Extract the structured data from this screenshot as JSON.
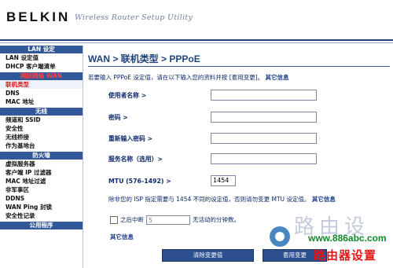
{
  "header": {
    "brand": "BELKIN",
    "tagline": "Wireless Router Setup Utility"
  },
  "sidebar": {
    "sections": [
      {
        "title": "LAN 设定",
        "items": [
          "LAN 设定值",
          "DHCP 客户端清单"
        ]
      },
      {
        "title": "网际网络 WAN",
        "items": [
          "联机类型",
          "DNS",
          "MAC 地址"
        ]
      },
      {
        "title": "无线",
        "items": [
          "频道和 SSID",
          "安全性",
          "无线桥接",
          "作为基地台"
        ]
      },
      {
        "title": "防火墙",
        "items": [
          "虚拟服务器",
          "客户端 IP 过滤器",
          "MAC 地址过滤",
          "非军事区",
          "DDNS",
          "WAN Ping 封锁",
          "安全性记录"
        ]
      },
      {
        "title": "公用程序",
        "items": []
      }
    ],
    "active_item": "联机类型"
  },
  "main": {
    "title": "WAN > 联机类型 > PPPoE",
    "intro": "若要输入 PPPoE 设定值，请在以下输入您的资料并按 [套用变更]。",
    "intro_link": "其它信息",
    "fields": [
      {
        "label": "使用者名称 >",
        "value": ""
      },
      {
        "label": "密码 >",
        "value": ""
      },
      {
        "label": "重新输入密码 >",
        "value": ""
      },
      {
        "label": "服务名称（选用）>",
        "value": ""
      }
    ],
    "mtu_label": "MTU (576-1492) >",
    "mtu_value": "1454",
    "note": "除非您的 ISP 指定需要与 1454 不同的设定值，否则请勿变更 MTU 设定值。",
    "note_link": "其它信息",
    "disconnect_label": "之后中断",
    "idle_value": "5",
    "idle_suffix": "无活动的分钟数。",
    "more_info": "其它信息",
    "buttons": {
      "clear": "清除变更值",
      "apply": "套用变更"
    }
  },
  "watermark": {
    "chars": "路由设",
    "url": "www.886abc.com",
    "name": "路由器设置"
  }
}
